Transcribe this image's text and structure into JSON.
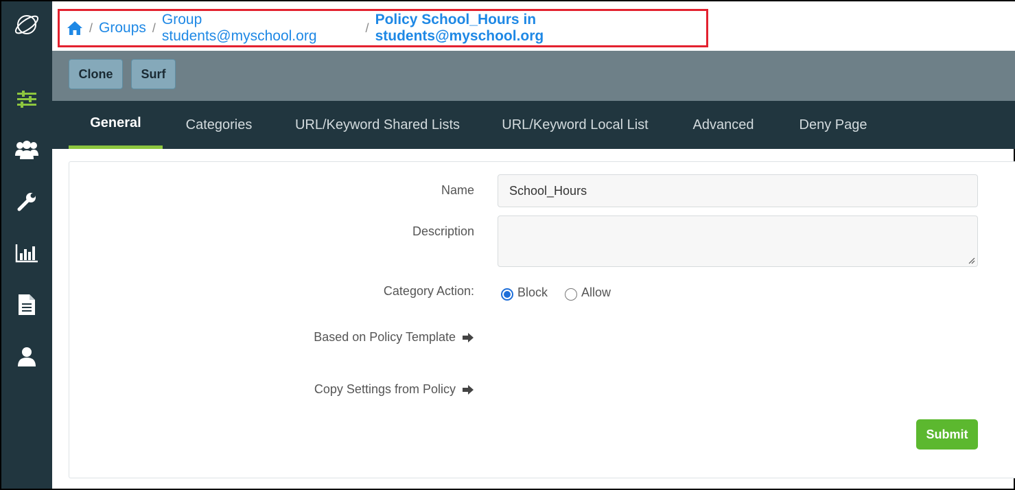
{
  "breadcrumb": {
    "items": [
      "Groups",
      "Group students@myschool.org"
    ],
    "current": "Policy School_Hours in students@myschool.org",
    "separator": "/"
  },
  "toolbar": {
    "clone_label": "Clone",
    "surf_label": "Surf"
  },
  "tabs": [
    "General",
    "Categories",
    "URL/Keyword Shared Lists",
    "URL/Keyword Local List",
    "Advanced",
    "Deny Page"
  ],
  "active_tab": "General",
  "form": {
    "name_label": "Name",
    "name_value": "School_Hours",
    "description_label": "Description",
    "description_value": "",
    "category_action_label": "Category Action:",
    "category_action_options": [
      "Block",
      "Allow"
    ],
    "category_action_selected": "Block",
    "template_label": "Based on Policy Template",
    "copy_label": "Copy Settings from Policy",
    "submit_label": "Submit"
  },
  "sidebar": {
    "icons": [
      "logo-icon",
      "policies-sliders-icon",
      "users-group-icon",
      "wrench-icon",
      "bar-chart-icon",
      "document-icon",
      "user-icon"
    ],
    "active": "policies-sliders-icon"
  },
  "colors": {
    "sidebar_bg": "#21363f",
    "toolbar_bg": "#6e8088",
    "accent_link": "#1e88e5",
    "highlight_border": "#e3212f",
    "active_tab_underline": "#8dc63f",
    "submit_bg": "#5cb82f"
  }
}
